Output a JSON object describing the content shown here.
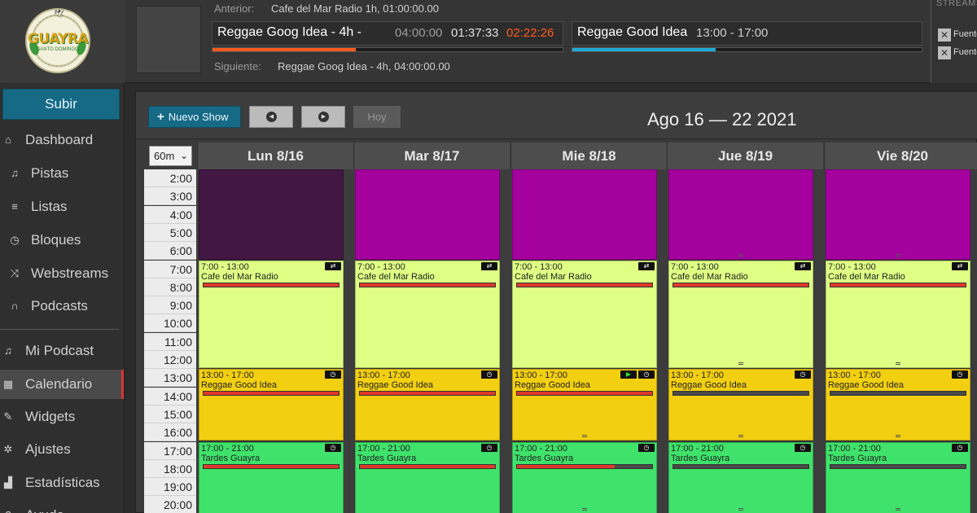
{
  "logo": {
    "text": "GUAYRA",
    "sub": "SANTO DOMINGO"
  },
  "player": {
    "prev_label": "Anterior:",
    "prev_value": "Cafe del Mar Radio 1h, 01:00:00.00",
    "next_label": "Siguiente:",
    "next_value": "Reggae Goog Idea - 4h, 04:00:00.00",
    "current_track": {
      "title": "Reggae Goog Idea - 4h -",
      "duration": "04:00:00",
      "elapsed": "01:37:33",
      "remaining": "02:22:26",
      "progress": 0.41,
      "bar_color": "#ff5a1e"
    },
    "current_show": {
      "title": "Reggae Good Idea",
      "range": "13:00 - 17:00",
      "progress": 0.41,
      "bar_color": "#1fa9d6"
    }
  },
  "streams": {
    "title": "STREAMS",
    "items": [
      "Fuente",
      "Fuente"
    ]
  },
  "sidebar": {
    "upload": "Subir",
    "items": [
      {
        "icon": "⌂",
        "label": "Dashboard",
        "name": "home-icon"
      },
      {
        "icon": "♫",
        "label": "Pistas",
        "name": "music-icon"
      },
      {
        "icon": "≡",
        "label": "Listas",
        "name": "list-icon"
      },
      {
        "icon": "◷",
        "label": "Bloques",
        "name": "clock-icon"
      },
      {
        "icon": "⤨",
        "label": "Webstreams",
        "name": "shuffle-icon"
      },
      {
        "icon": "∩",
        "label": "Podcasts",
        "name": "headphones-icon"
      },
      {
        "icon": "♫",
        "label": "Mi Podcast",
        "name": "music-icon"
      },
      {
        "icon": "▦",
        "label": "Calendario",
        "name": "calendar-icon"
      },
      {
        "icon": "✎",
        "label": "Widgets",
        "name": "wrench-icon"
      },
      {
        "icon": "✲",
        "label": "Ajustes",
        "name": "gear-icon"
      },
      {
        "icon": "▟",
        "label": "Estadísticas",
        "name": "stats-icon"
      },
      {
        "icon": "?",
        "label": "Ayuda",
        "name": "help-icon"
      }
    ]
  },
  "calendar": {
    "new_show": "Nuevo Show",
    "today": "Hoy",
    "range_title": "Ago 16 — 22 2021",
    "interval": "60m",
    "days": [
      "Lun 8/16",
      "Mar 8/17",
      "Mie 8/18",
      "Jue 8/19",
      "Vie 8/20"
    ],
    "times": [
      "2:00",
      "3:00",
      "4:00",
      "5:00",
      "6:00",
      "7:00",
      "8:00",
      "9:00",
      "10:00",
      "11:00",
      "12:00",
      "13:00",
      "14:00",
      "15:00",
      "16:00",
      "17:00",
      "18:00",
      "19:00",
      "20:00"
    ],
    "colors": {
      "night_past": "#421744",
      "night": "#a5019f",
      "morning": "#deff84",
      "afternoon": "#f3cf12",
      "evening": "#3fe26a"
    },
    "shows": [
      {
        "time": "7:00 - 13:00",
        "name": "Cafe del Mar Radio",
        "icon": "stream-icon",
        "progress": [
          1,
          1,
          1,
          1,
          1
        ]
      },
      {
        "time": "13:00 - 17:00",
        "name": "Reggae Good Idea",
        "icon": "clock-icon",
        "progress": [
          1,
          1,
          1,
          0,
          0
        ]
      },
      {
        "time": "17:00 - 21:00",
        "name": "Tardes Guayra",
        "icon": "clock-icon",
        "progress": [
          1,
          1,
          0.72,
          0,
          0
        ]
      }
    ]
  }
}
